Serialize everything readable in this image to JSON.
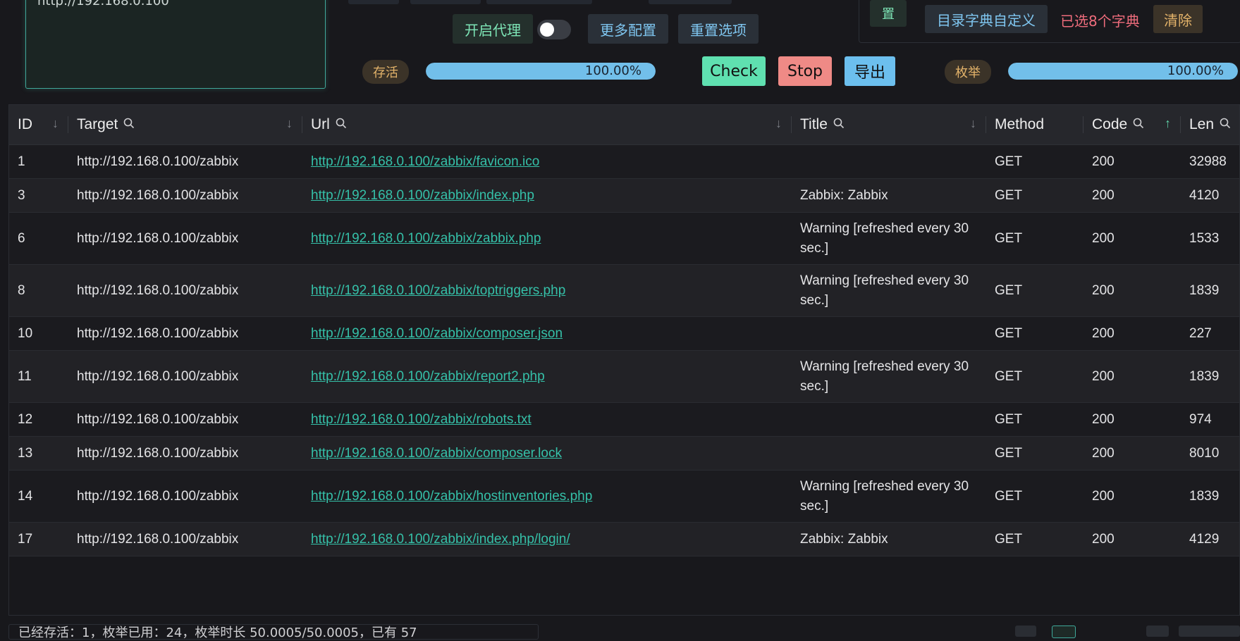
{
  "targets": {
    "value": "http://192.168.0.100"
  },
  "options": {
    "proxy_label": "开启代理",
    "more_config": "更多配置",
    "reset_options": "重置选项",
    "config_fragment": "置",
    "dict_custom": "目录字典自定义",
    "dict_selected": "已选8个字典",
    "clear": "清除"
  },
  "progress": {
    "alive_label": "存活",
    "alive_value": 100,
    "alive_text": "100.00%",
    "enum_label": "枚举",
    "enum_value": 100,
    "enum_text": "100.00%"
  },
  "actions": {
    "check": "Check",
    "stop": "Stop",
    "export": "导出"
  },
  "colors": {
    "accent_green": "#5fe0b0",
    "stop_red": "#ef8a86",
    "export_blue": "#6cbfee",
    "link": "#35c0a8",
    "warn": "#ee6c7c"
  },
  "table": {
    "columns": [
      {
        "label": "ID",
        "searchable": false,
        "sortable": true,
        "sort_state": "none"
      },
      {
        "label": "Target",
        "searchable": true,
        "sortable": true,
        "sort_state": "none"
      },
      {
        "label": "Url",
        "searchable": true,
        "sortable": true,
        "sort_state": "none"
      },
      {
        "label": "Title",
        "searchable": true,
        "sortable": true,
        "sort_state": "none"
      },
      {
        "label": "Method",
        "searchable": false,
        "sortable": false
      },
      {
        "label": "Code",
        "searchable": true,
        "sortable": true,
        "sort_state": "asc"
      },
      {
        "label": "Len",
        "searchable": true,
        "sortable": false
      }
    ],
    "rows": [
      {
        "id": "1",
        "target": "http://192.168.0.100/zabbix",
        "url": "http://192.168.0.100/zabbix/favicon.ico",
        "title": "",
        "method": "GET",
        "code": "200",
        "len": "32988"
      },
      {
        "id": "3",
        "target": "http://192.168.0.100/zabbix",
        "url": "http://192.168.0.100/zabbix/index.php",
        "title": "Zabbix: Zabbix",
        "method": "GET",
        "code": "200",
        "len": "4120"
      },
      {
        "id": "6",
        "target": "http://192.168.0.100/zabbix",
        "url": "http://192.168.0.100/zabbix/zabbix.php",
        "title": "Warning [refreshed every 30 sec.]",
        "method": "GET",
        "code": "200",
        "len": "1533"
      },
      {
        "id": "8",
        "target": "http://192.168.0.100/zabbix",
        "url": "http://192.168.0.100/zabbix/toptriggers.php",
        "title": "Warning [refreshed every 30 sec.]",
        "method": "GET",
        "code": "200",
        "len": "1839"
      },
      {
        "id": "10",
        "target": "http://192.168.0.100/zabbix",
        "url": "http://192.168.0.100/zabbix/composer.json",
        "title": "",
        "method": "GET",
        "code": "200",
        "len": "227"
      },
      {
        "id": "11",
        "target": "http://192.168.0.100/zabbix",
        "url": "http://192.168.0.100/zabbix/report2.php",
        "title": "Warning [refreshed every 30 sec.]",
        "method": "GET",
        "code": "200",
        "len": "1839"
      },
      {
        "id": "12",
        "target": "http://192.168.0.100/zabbix",
        "url": "http://192.168.0.100/zabbix/robots.txt",
        "title": "",
        "method": "GET",
        "code": "200",
        "len": "974"
      },
      {
        "id": "13",
        "target": "http://192.168.0.100/zabbix",
        "url": "http://192.168.0.100/zabbix/composer.lock",
        "title": "",
        "method": "GET",
        "code": "200",
        "len": "8010"
      },
      {
        "id": "14",
        "target": "http://192.168.0.100/zabbix",
        "url": "http://192.168.0.100/zabbix/hostinventories.php",
        "title": "Warning [refreshed every 30 sec.]",
        "method": "GET",
        "code": "200",
        "len": "1839"
      },
      {
        "id": "17",
        "target": "http://192.168.0.100/zabbix",
        "url": "http://192.168.0.100/zabbix/index.php/login/",
        "title": "Zabbix: Zabbix",
        "method": "GET",
        "code": "200",
        "len": "4129"
      }
    ]
  },
  "footer": {
    "status_text": "已经存活：1，枚举已用：24，枚举时长 50.0005/50.0005，已有 57"
  }
}
